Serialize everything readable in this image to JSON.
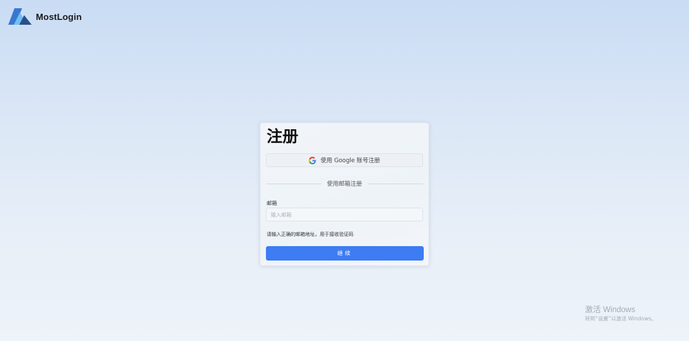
{
  "brand": {
    "name": "MostLogin"
  },
  "signup": {
    "title": "注册",
    "google_button_label": "使用 Google 账号注册",
    "divider_label": "使用邮箱注册",
    "email_label": "邮箱",
    "email_placeholder": "输入邮箱",
    "email_value": "",
    "hint": "请输入正确的邮箱地址，用于接收验证码",
    "continue_label": "继续"
  },
  "watermark": {
    "title": "激活 Windows",
    "subtitle": "转到“设置”以激活 Windows。"
  },
  "icons": {
    "brand_logo": "mostlogin-logo",
    "google": "google-g-icon"
  },
  "colors": {
    "primary": "#3d7cf2",
    "logo_dark": "#2a4f8a",
    "logo_light": "#6fc0f0"
  }
}
